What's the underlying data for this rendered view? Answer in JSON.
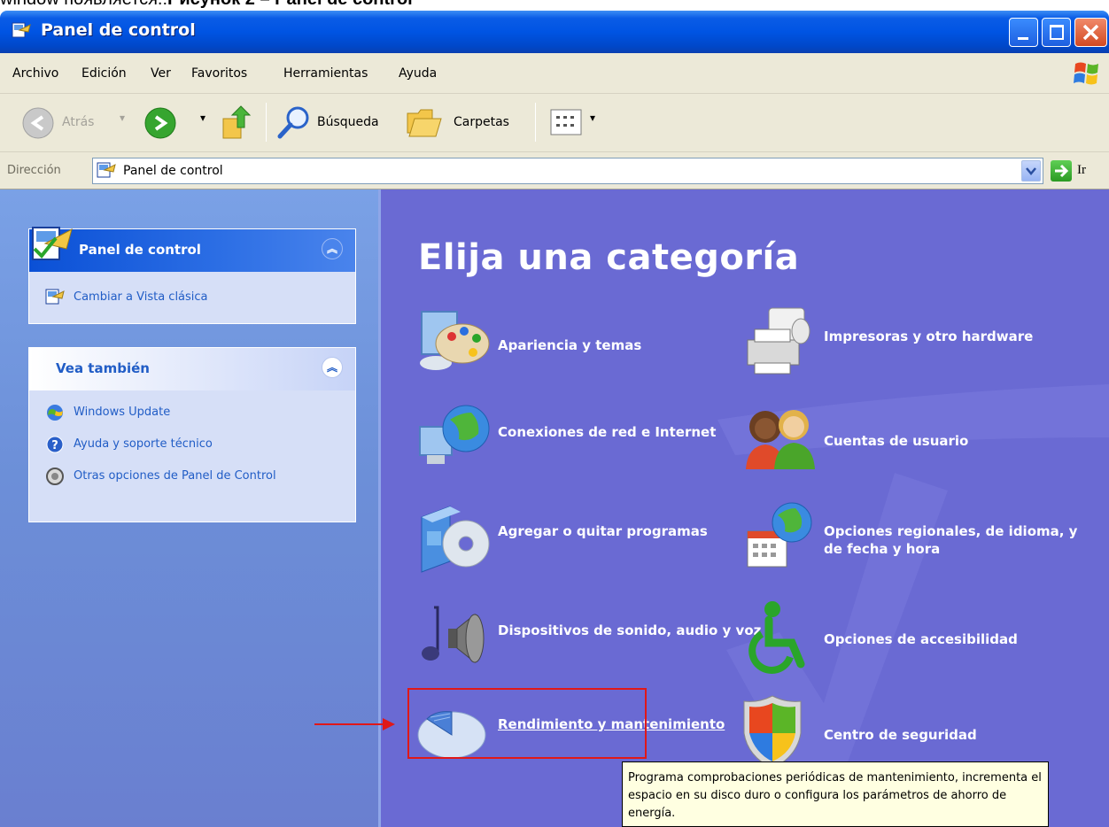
{
  "caption": {
    "prefix": "window появляется.:",
    "figure": "Рисунок 2 – Panel de control"
  },
  "window": {
    "title": "Panel de control",
    "controls": [
      "minimize",
      "maximize",
      "close"
    ]
  },
  "menu": [
    "Archivo",
    "Edición",
    "Ver",
    "Favoritos",
    "Herramientas",
    "Ayuda"
  ],
  "toolbar": {
    "back_label": "Atrás",
    "search_label": "Búsqueda",
    "folders_label": "Carpetas"
  },
  "address": {
    "label": "Dirección",
    "value": "Panel de control",
    "go_label": "Ir"
  },
  "sidebar": {
    "panel1": {
      "title": "Panel de control",
      "links": [
        "Cambiar a Vista clásica"
      ]
    },
    "panel2": {
      "title": "Vea también",
      "links": [
        "Windows Update",
        "Ayuda y soporte técnico",
        "Otras opciones de Panel de Control"
      ]
    }
  },
  "main": {
    "heading": "Elija una categoría",
    "categories": [
      {
        "label": "Apariencia y temas",
        "icon": "appearance-icon"
      },
      {
        "label": "Impresoras y otro hardware",
        "icon": "printer-icon"
      },
      {
        "label": "Conexiones de red e Internet",
        "icon": "network-icon"
      },
      {
        "label": "Cuentas de usuario",
        "icon": "users-icon"
      },
      {
        "label": "Agregar o quitar programas",
        "icon": "add-remove-programs-icon"
      },
      {
        "label": "Opciones regionales, de idioma, y de fecha y hora",
        "icon": "regional-options-icon"
      },
      {
        "label": "Dispositivos de sonido, audio y voz",
        "icon": "sound-icon"
      },
      {
        "label": "Opciones de accesibilidad",
        "icon": "accessibility-icon"
      },
      {
        "label": "Rendimiento y mantenimiento",
        "icon": "performance-icon"
      },
      {
        "label": "Centro de seguridad",
        "icon": "security-center-icon"
      }
    ],
    "tooltip": "Programa comprobaciones periódicas de mantenimiento, incrementa el espacio en su disco duro o configura los parámetros de ahorro de energía."
  },
  "colors": {
    "title_bar": "#0054e3",
    "right_pane": "#6a6ad3",
    "left_pane": "#6c8fd8",
    "highlight": "#e01818"
  }
}
